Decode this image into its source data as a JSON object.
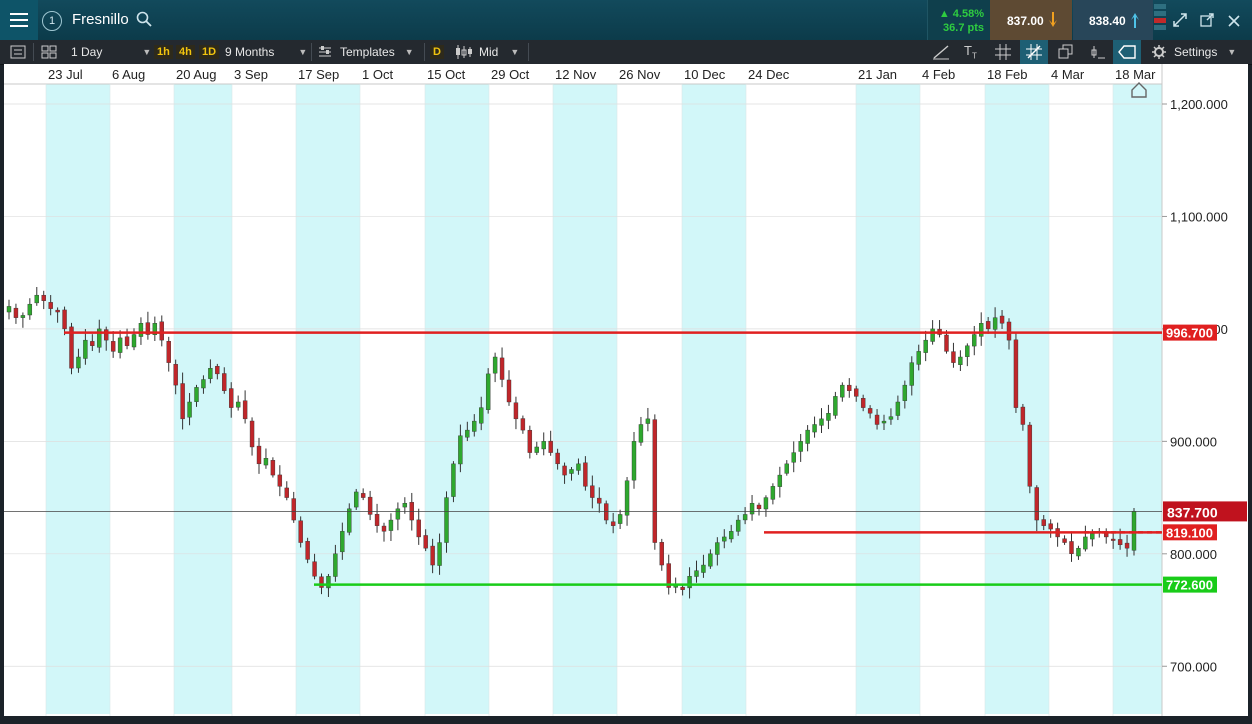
{
  "app": {
    "instrument": "Fresnillo",
    "change_pct": "▲ 4.58%",
    "change_pts": "36.7 pts",
    "sell_price": "837.00",
    "buy_price": "838.40",
    "step_number": "1"
  },
  "toolbar": {
    "interval": "1 Day",
    "quick_1h": "1h",
    "quick_4h": "4h",
    "quick_1d": "1D",
    "range": "9 Months",
    "templates": "Templates",
    "d_button": "D",
    "price_type": "Mid",
    "settings": "Settings"
  },
  "colors": {
    "resistance": "#e02020",
    "support": "#19cc19",
    "up_candle": "#2ea82e",
    "down_candle": "#c0262a",
    "band": "#d2f7f9"
  },
  "chart_data": {
    "type": "candlestick",
    "instrument": "Fresnillo",
    "x_ticks": [
      "23 Jul",
      "6 Aug",
      "20 Aug",
      "3 Sep",
      "17 Sep",
      "1 Oct",
      "15 Oct",
      "29 Oct",
      "12 Nov",
      "26 Nov",
      "10 Dec",
      "24 Dec",
      "21 Jan",
      "4 Feb",
      "18 Feb",
      "4 Mar",
      "18 Mar"
    ],
    "y_ticks": [
      "1,200.000",
      "1,100.000",
      "1,000.000",
      "900.000",
      "800.000",
      "700.000"
    ],
    "y_tick_values": [
      1200,
      1100,
      1000,
      900,
      800,
      700
    ],
    "ylim": [
      665,
      1215
    ],
    "current_price": 837.7,
    "current_price_label": "837.700",
    "levels": [
      {
        "label": "996.700",
        "value": 996.7,
        "color": "red",
        "style": "solid",
        "from": "23 Jul"
      },
      {
        "label": "819.100",
        "value": 819.1,
        "color": "red",
        "style": "solid",
        "from": "24 Dec"
      },
      {
        "label": "772.600",
        "value": 772.6,
        "color": "green",
        "style": "solid",
        "from": "17 Sep"
      }
    ],
    "closes": [
      1020,
      1010,
      1012,
      1022,
      1030,
      1025,
      1018,
      1015,
      1000,
      965,
      975,
      990,
      985,
      1000,
      990,
      980,
      992,
      985,
      995,
      1005,
      995,
      1005,
      990,
      970,
      950,
      920,
      935,
      948,
      955,
      965,
      960,
      945,
      930,
      935,
      920,
      895,
      880,
      885,
      870,
      860,
      850,
      830,
      810,
      795,
      780,
      770,
      780,
      800,
      820,
      840,
      855,
      850,
      835,
      825,
      820,
      830,
      840,
      845,
      830,
      815,
      805,
      790,
      810,
      850,
      880,
      905,
      910,
      918,
      930,
      960,
      975,
      955,
      935,
      920,
      910,
      890,
      895,
      900,
      890,
      880,
      870,
      875,
      880,
      860,
      850,
      845,
      830,
      825,
      835,
      865,
      900,
      915,
      920,
      810,
      790,
      770,
      772,
      768,
      780,
      785,
      790,
      800,
      810,
      815,
      820,
      830,
      835,
      845,
      840,
      850,
      860,
      870,
      880,
      890,
      900,
      910,
      915,
      920,
      925,
      940,
      950,
      945,
      940,
      930,
      925,
      915,
      918,
      922,
      935,
      950,
      970,
      980,
      990,
      1000,
      995,
      980,
      970,
      975,
      985,
      995,
      1005,
      1000,
      1010,
      1005,
      990,
      930,
      915,
      860,
      830,
      825,
      822,
      815,
      810,
      800,
      805,
      815,
      818,
      820,
      815,
      812,
      808,
      805,
      837.7
    ]
  }
}
